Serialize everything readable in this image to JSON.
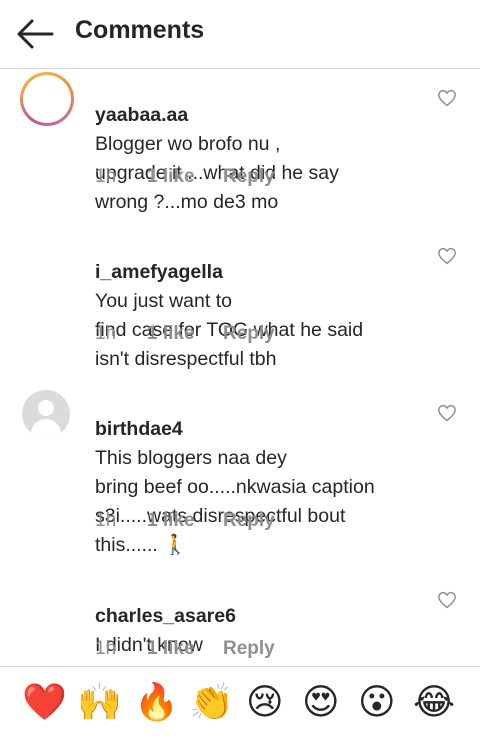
{
  "header": {
    "title": "Comments"
  },
  "comments": [
    {
      "username": "yaabaa.aa",
      "text": "Blogger wo brofo nu ,\nupgrade it ...what did he say\nwrong ?...mo de3 mo",
      "time": "1h",
      "likes": "1 like",
      "reply": "Reply",
      "avatar": "story-ring"
    },
    {
      "username": "i_amefyagella",
      "text": "You just want to\nfind case for TOG what he said\nisn't disrespectful tbh",
      "time": "1h",
      "likes": "1 like",
      "reply": "Reply",
      "avatar": "none"
    },
    {
      "username": "birthdae4",
      "text": "This bloggers naa dey\nbring beef oo.....nkwasia caption\ns3i.....wats disrespectful bout\nthis...... 🚶",
      "time": "1h",
      "likes": "1 like",
      "reply": "Reply",
      "avatar": "default-gray"
    },
    {
      "username": "charles_asare6",
      "text": "I  didn't know\nabout stormzy",
      "time": "1h",
      "likes": "1 like",
      "reply": "Reply",
      "avatar": "none"
    }
  ],
  "reactions": [
    "❤️",
    "🙌",
    "🔥",
    "👏",
    "😢",
    "😍",
    "😮",
    "😂"
  ]
}
